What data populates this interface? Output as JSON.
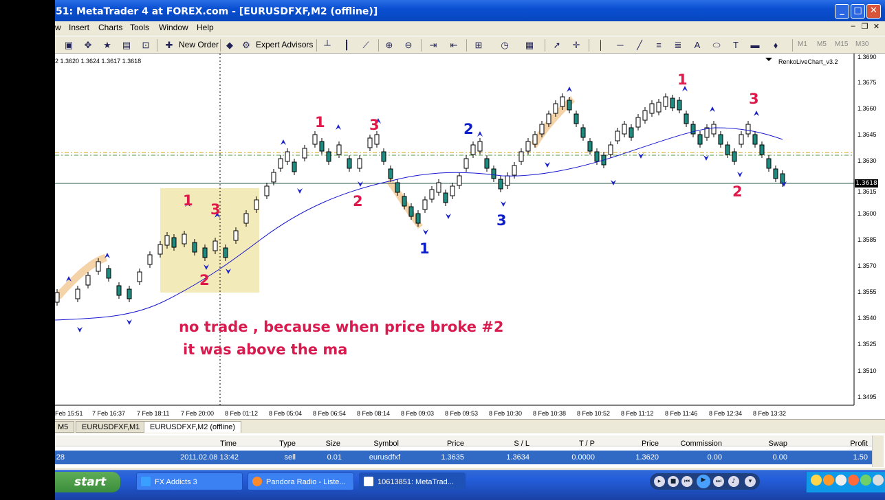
{
  "window": {
    "title": "51: MetaTrader 4 at FOREX.com - [EURUSDFXF,M2 (offline)]"
  },
  "menu": [
    "w",
    "Insert",
    "Charts",
    "Tools",
    "Window",
    "Help"
  ],
  "toolbar": {
    "new_order": "New Order",
    "expert_advisors": "Expert Advisors",
    "timeframes": [
      "M1",
      "M5",
      "M15",
      "M30"
    ]
  },
  "chart": {
    "ohlc_header": "2  1.3620 1.3624 1.3617 1.3618",
    "indicator_name": "RenkoLiveChart_v3.2",
    "current_price": "1.3618",
    "price_axis": [
      "1.3690",
      "1.3675",
      "1.3660",
      "1.3645",
      "1.3630",
      "1.3615",
      "1.3600",
      "1.3585",
      "1.3570",
      "1.3555",
      "1.3540",
      "1.3525",
      "1.3510",
      "1.3495"
    ],
    "time_axis": [
      "Feb 15:51",
      "7 Feb 16:37",
      "7 Feb 18:11",
      "7 Feb 20:00",
      "8 Feb 01:12",
      "8 Feb 05:04",
      "8 Feb 06:54",
      "8 Feb 08:14",
      "8 Feb 09:03",
      "8 Feb 09:53",
      "8 Feb 10:30",
      "8 Feb 10:38",
      "8 Feb 10:52",
      "8 Feb 11:12",
      "8 Feb 11:46",
      "8 Feb 12:34",
      "8 Feb 13:32"
    ],
    "annotations": {
      "a1": "1",
      "a3": "3",
      "a2": "2",
      "b1": "1",
      "b3": "3",
      "b2": "2",
      "c2": "2",
      "c3": "3",
      "c1": "1",
      "d1": "1",
      "d3": "3",
      "d2": "2"
    },
    "note_line1": "no trade , because when price broke #2",
    "note_line2": "it was above the ma",
    "colors": {
      "bull": "#ffffff",
      "bear": "#1f8a7f",
      "ma": "#1515d0",
      "red_ann": "#e0194b",
      "blue_ann": "#0d1ec8",
      "highlight": "#f3eab9"
    }
  },
  "tabs": [
    "M5",
    "EURUSDFXF,M1",
    "EURUSDFXF,M2 (offline)"
  ],
  "terminal": {
    "headers": [
      "Time",
      "Type",
      "Size",
      "Symbol",
      "Price",
      "S / L",
      "T / P",
      "Price",
      "Commission",
      "Swap",
      "Profit"
    ],
    "row": {
      "id": "28",
      "time": "2011.02.08 13:42",
      "type": "sell",
      "size": "0.01",
      "symbol": "eurusdfxf",
      "price": "1.3635",
      "sl": "1.3634",
      "tp": "0.0000",
      "cur_price": "1.3620",
      "commission": "0.00",
      "swap": "0.00",
      "profit": "1.50"
    }
  },
  "taskbar": {
    "start": "start",
    "tasks": [
      "FX Addicts 3",
      "Pandora Radio - Liste...",
      "10613851: MetaTrad..."
    ]
  }
}
